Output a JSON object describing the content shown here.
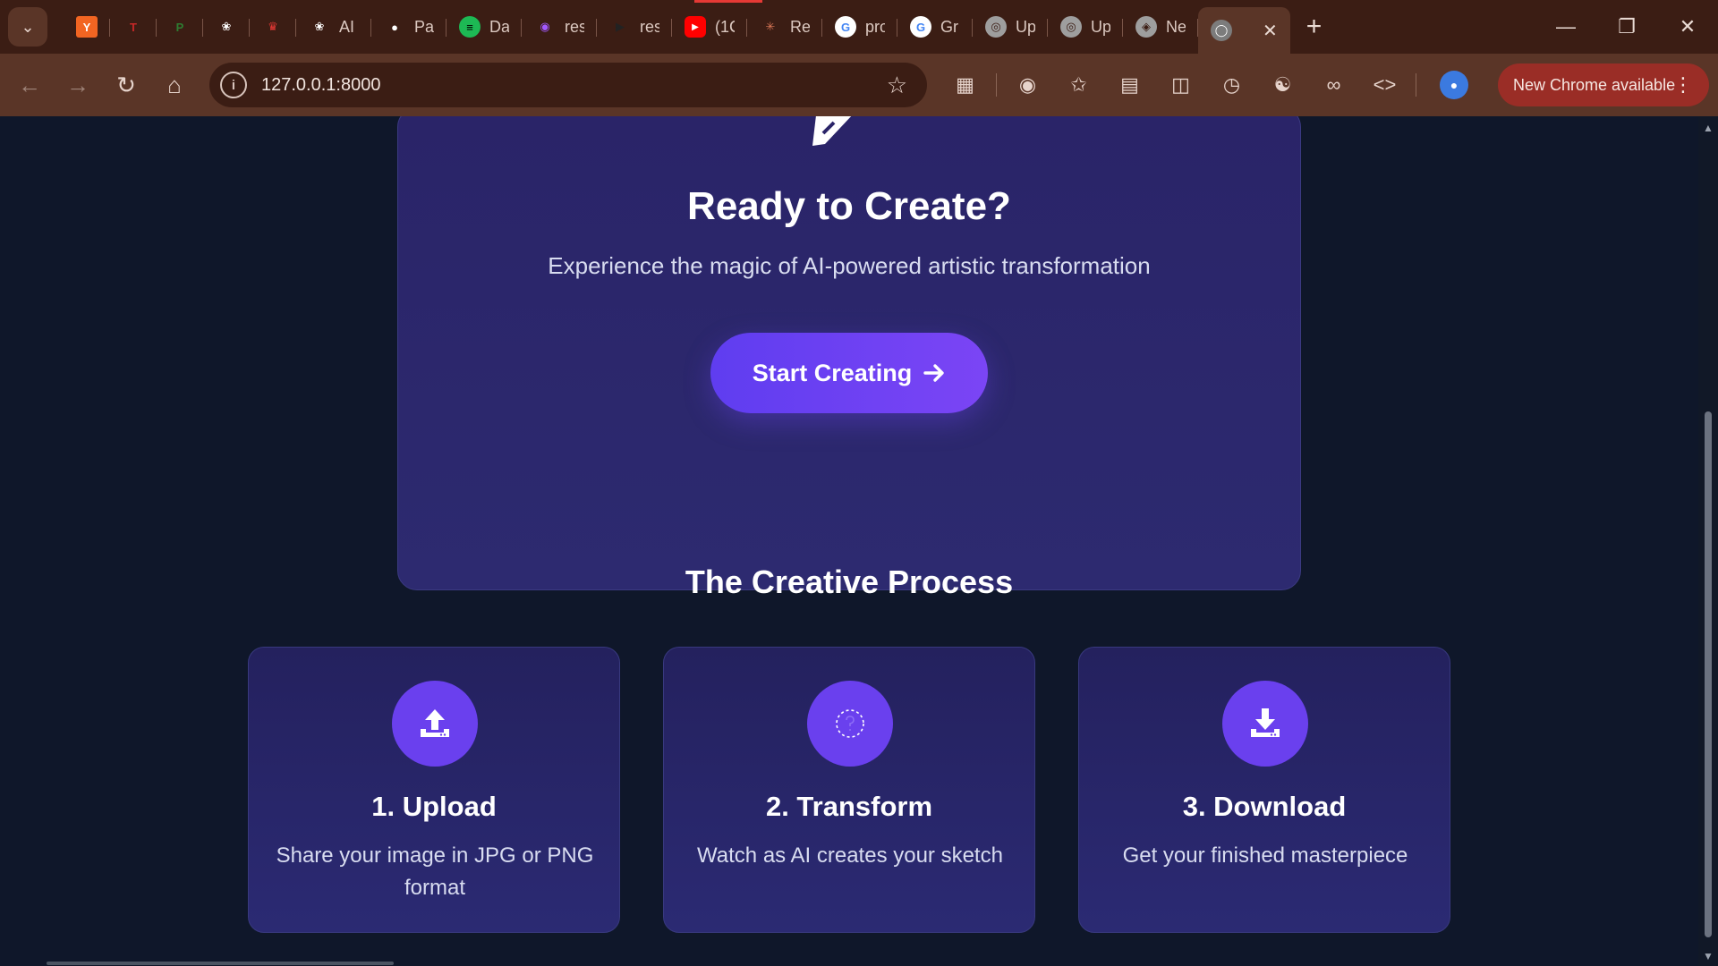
{
  "browser": {
    "tabs": [
      {
        "icon": "y-combinator-icon",
        "title": "",
        "color": "#f26522"
      },
      {
        "icon": "tj-icon",
        "title": "",
        "color": "#c62828"
      },
      {
        "icon": "p-icon",
        "title": "",
        "color": "#2e7d32"
      },
      {
        "icon": "openai-icon",
        "title": "",
        "color": "#ffffff"
      },
      {
        "icon": "crown-icon",
        "title": "",
        "color": "#e53935"
      },
      {
        "icon": "openai-icon",
        "title": "AI",
        "color": "#ffffff"
      },
      {
        "icon": "github-icon",
        "title": "Pa",
        "color": "#ffffff"
      },
      {
        "icon": "spotify-icon",
        "title": "Da",
        "color": "#1db954"
      },
      {
        "icon": "figma-icon",
        "title": "res",
        "color": "#a259ff"
      },
      {
        "icon": "play-icon",
        "title": "res",
        "color": "#222222"
      },
      {
        "icon": "youtube-icon",
        "title": "(1C",
        "color": "#ff0000"
      },
      {
        "icon": "claude-icon",
        "title": "Re",
        "color": "#d97757"
      },
      {
        "icon": "google-icon",
        "title": "pro",
        "color": "#4285f4"
      },
      {
        "icon": "google-icon",
        "title": "Gr",
        "color": "#4285f4"
      },
      {
        "icon": "globe-icon",
        "title": "Up",
        "color": "#9e9e9e"
      },
      {
        "icon": "globe-icon",
        "title": "Up",
        "color": "#9e9e9e"
      },
      {
        "icon": "shield-icon",
        "title": "Ne",
        "color": "#9e9e9e"
      }
    ],
    "active_tab": {
      "icon": "globe-icon",
      "title": ""
    },
    "url": "127.0.0.1:8000",
    "update_label": "New Chrome available"
  },
  "cta": {
    "title": "Ready to Create?",
    "subtitle": "Experience the magic of AI-powered artistic transformation",
    "button_label": "Start Creating"
  },
  "process": {
    "title": "The Creative Process",
    "steps": [
      {
        "icon": "upload-icon",
        "title": "1. Upload",
        "description": "Share your image in JPG or PNG format"
      },
      {
        "icon": "transform-icon",
        "title": "2. Transform",
        "description": "Watch as AI creates your sketch"
      },
      {
        "icon": "download-icon",
        "title": "3. Download",
        "description": "Get your finished masterpiece"
      }
    ]
  },
  "colors": {
    "page_bg": "#0f172a",
    "card_bg": "#2a2468",
    "accent": "#6a40ee",
    "chrome_frame": "#3b1d14",
    "chrome_toolbar": "#5a3527"
  }
}
